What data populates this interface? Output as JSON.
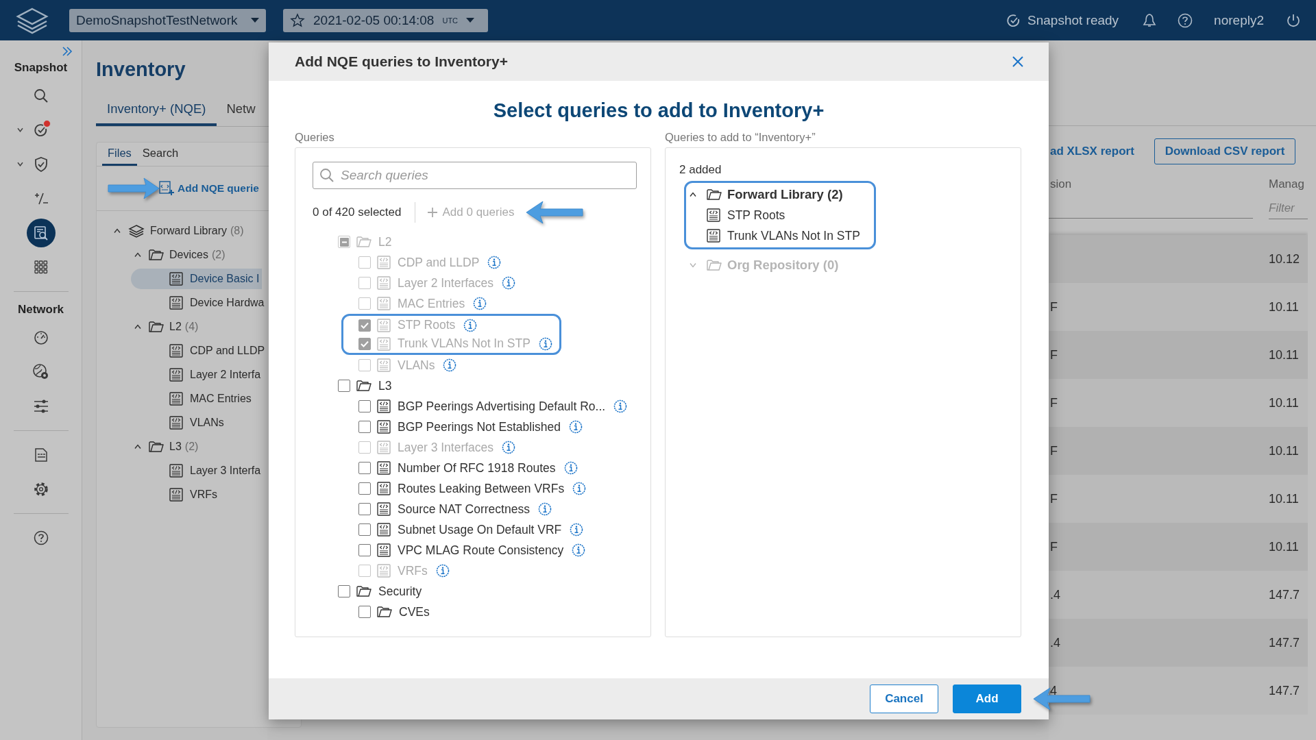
{
  "top_bar": {
    "network": "DemoSnapshotTestNetwork",
    "snapshot_date": "2021-02-05 00:14:08",
    "snapshot_zone": "UTC",
    "status": "Snapshot ready",
    "user": "noreply2"
  },
  "rail": {
    "sections": [
      {
        "label": "Snapshot",
        "items": [
          {
            "kind": "search",
            "selected": false,
            "chevron": false,
            "alert": false
          },
          {
            "kind": "checks",
            "selected": false,
            "chevron": true,
            "alert": true
          },
          {
            "kind": "shield",
            "selected": false,
            "chevron": true,
            "alert": false
          },
          {
            "kind": "diff",
            "selected": false,
            "chevron": false,
            "alert": false
          },
          {
            "kind": "queries",
            "selected": true,
            "chevron": false,
            "alert": false
          },
          {
            "kind": "apps",
            "selected": false,
            "chevron": false,
            "alert": false
          }
        ]
      },
      {
        "label": "Network",
        "items": [
          {
            "kind": "gauge",
            "selected": false,
            "chevron": false,
            "alert": false
          },
          {
            "kind": "globe",
            "selected": false,
            "chevron": false,
            "alert": false
          },
          {
            "kind": "sliders",
            "selected": false,
            "chevron": false,
            "alert": false
          }
        ]
      },
      {
        "items": [
          {
            "kind": "nqe",
            "selected": false,
            "chevron": false,
            "alert": false
          },
          {
            "kind": "settings",
            "selected": false,
            "chevron": false,
            "alert": false
          }
        ]
      },
      {
        "items": [
          {
            "kind": "help",
            "selected": false,
            "chevron": false,
            "alert": false
          }
        ]
      }
    ]
  },
  "page": {
    "title": "Inventory",
    "tabs": [
      {
        "label": "Inventory+ (NQE)",
        "selected": true
      },
      {
        "label": "Netw",
        "selected": false
      }
    ],
    "file_tabs": [
      {
        "label": "Files",
        "selected": true
      },
      {
        "label": "Search",
        "selected": false
      }
    ],
    "add_link": {
      "label": "Add NQE querie",
      "callout": true
    },
    "tree": [
      {
        "label": "Forward Library",
        "count": "(8)",
        "kind": "library",
        "expanded": true,
        "children": [
          {
            "label": "Devices",
            "count": "(2)",
            "kind": "folder",
            "expanded": true,
            "children": [
              {
                "label": "Device Basic I",
                "kind": "query",
                "selected": true
              },
              {
                "label": "Device Hardwa",
                "kind": "query",
                "selected": false
              }
            ]
          },
          {
            "label": "L2",
            "count": "(4)",
            "kind": "folder",
            "expanded": true,
            "children": [
              {
                "label": "CDP and LLDP",
                "kind": "query",
                "selected": false
              },
              {
                "label": "Layer 2 Interfa",
                "kind": "query",
                "selected": false
              },
              {
                "label": "MAC Entries",
                "kind": "query",
                "selected": false
              },
              {
                "label": "VLANs",
                "kind": "query",
                "selected": false
              }
            ]
          },
          {
            "label": "L3",
            "count": "(2)",
            "kind": "folder",
            "expanded": true,
            "children": [
              {
                "label": "Layer 3 Interfa",
                "kind": "query",
                "selected": false
              },
              {
                "label": "VRFs",
                "kind": "query",
                "selected": false
              }
            ]
          }
        ]
      }
    ]
  },
  "report": {
    "xlsx_link": "ad XLSX report",
    "csv_button": "Download CSV report",
    "columns": [
      {
        "label": "sion"
      },
      {
        "label": "Manag",
        "filter_placeholder": "Filter"
      }
    ],
    "rows": [
      {
        "column_2": "10.12"
      },
      {
        "column_1": "F",
        "column_2": "10.11"
      },
      {
        "column_1": "F",
        "column_2": "10.11"
      },
      {
        "column_1": "F",
        "column_2": "10.11"
      },
      {
        "column_1": "F",
        "column_2": "10.11"
      },
      {
        "column_1": "F",
        "column_2": "10.11"
      },
      {
        "column_1": "F",
        "column_2": "10.11"
      },
      {
        "column_1": ".4",
        "column_2": "147.7"
      },
      {
        "column_1": ".4",
        "column_2": "147.7"
      },
      {
        "column_1": "4",
        "column_2": "147.7"
      }
    ]
  },
  "modal": {
    "title": "Add NQE queries to Inventory+",
    "heading": "Select queries to add to Inventory+",
    "queries_label": "Queries",
    "search_placeholder": "Search queries",
    "selected_count": "0 of 420 selected",
    "add_queries": {
      "label": "Add 0 queries",
      "disabled": true,
      "callout": true
    },
    "tree": [
      {
        "label": "L2",
        "kind": "folder",
        "checked": false,
        "indeterminate": true,
        "disabled": true,
        "highlighted": false,
        "children": [
          {
            "label": "CDP and LLDP",
            "kind": "query",
            "checked": false,
            "indeterminate": false,
            "disabled": true,
            "highlighted": false
          },
          {
            "label": "Layer 2 Interfaces",
            "kind": "query",
            "checked": false,
            "indeterminate": false,
            "disabled": true,
            "highlighted": false
          },
          {
            "label": "MAC Entries",
            "kind": "query",
            "checked": false,
            "indeterminate": false,
            "disabled": true,
            "highlighted": false
          },
          {
            "label": "STP Roots",
            "kind": "query",
            "checked": true,
            "indeterminate": false,
            "disabled": true,
            "highlighted": true
          },
          {
            "label": "Trunk VLANs Not In STP",
            "kind": "query",
            "checked": true,
            "indeterminate": false,
            "disabled": true,
            "highlighted": true
          },
          {
            "label": "VLANs",
            "kind": "query",
            "checked": false,
            "indeterminate": false,
            "disabled": true,
            "highlighted": false
          }
        ]
      },
      {
        "label": "L3",
        "kind": "folder",
        "checked": false,
        "indeterminate": false,
        "disabled": false,
        "highlighted": false,
        "children": [
          {
            "label": "BGP Peerings Advertising Default Ro...",
            "kind": "query",
            "checked": false,
            "indeterminate": false,
            "disabled": false,
            "highlighted": false
          },
          {
            "label": "BGP Peerings Not Established",
            "kind": "query",
            "checked": false,
            "indeterminate": false,
            "disabled": false,
            "highlighted": false
          },
          {
            "label": "Layer 3 Interfaces",
            "kind": "query",
            "checked": false,
            "indeterminate": false,
            "disabled": true,
            "highlighted": false
          },
          {
            "label": "Number Of RFC 1918 Routes",
            "kind": "query",
            "checked": false,
            "indeterminate": false,
            "disabled": false,
            "highlighted": false
          },
          {
            "label": "Routes Leaking Between VRFs",
            "kind": "query",
            "checked": false,
            "indeterminate": false,
            "disabled": false,
            "highlighted": false
          },
          {
            "label": "Source NAT Correctness",
            "kind": "query",
            "checked": false,
            "indeterminate": false,
            "disabled": false,
            "highlighted": false
          },
          {
            "label": "Subnet Usage On Default VRF",
            "kind": "query",
            "checked": false,
            "indeterminate": false,
            "disabled": false,
            "highlighted": false
          },
          {
            "label": "VPC MLAG Route Consistency",
            "kind": "query",
            "checked": false,
            "indeterminate": false,
            "disabled": false,
            "highlighted": false
          },
          {
            "label": "VRFs",
            "kind": "query",
            "checked": false,
            "indeterminate": false,
            "disabled": true,
            "highlighted": false
          }
        ]
      },
      {
        "label": "Security",
        "kind": "folder",
        "checked": false,
        "indeterminate": false,
        "disabled": false,
        "highlighted": false,
        "children": [
          {
            "label": "CVEs",
            "kind": "folder",
            "checked": false,
            "indeterminate": false,
            "disabled": false,
            "highlighted": false
          }
        ]
      }
    ],
    "added_label": "Queries to add to “Inventory+”",
    "added_count": "2 added",
    "added_tree": [
      {
        "label": "Forward Library (2)",
        "kind": "folder",
        "expanded": true,
        "disabled": false,
        "highlighted": true,
        "children": [
          {
            "label": "STP Roots",
            "kind": "query",
            "disabled": false,
            "highlighted": false
          },
          {
            "label": "Trunk VLANs Not In STP",
            "kind": "query",
            "disabled": false,
            "highlighted": false
          }
        ]
      },
      {
        "label": "Org Repository (0)",
        "kind": "folder",
        "expanded": false,
        "disabled": true,
        "highlighted": false
      }
    ],
    "buttons": [
      {
        "label": "Cancel",
        "kind": "secondary",
        "callout": false
      },
      {
        "label": "Add",
        "kind": "primary",
        "callout": true
      }
    ]
  }
}
